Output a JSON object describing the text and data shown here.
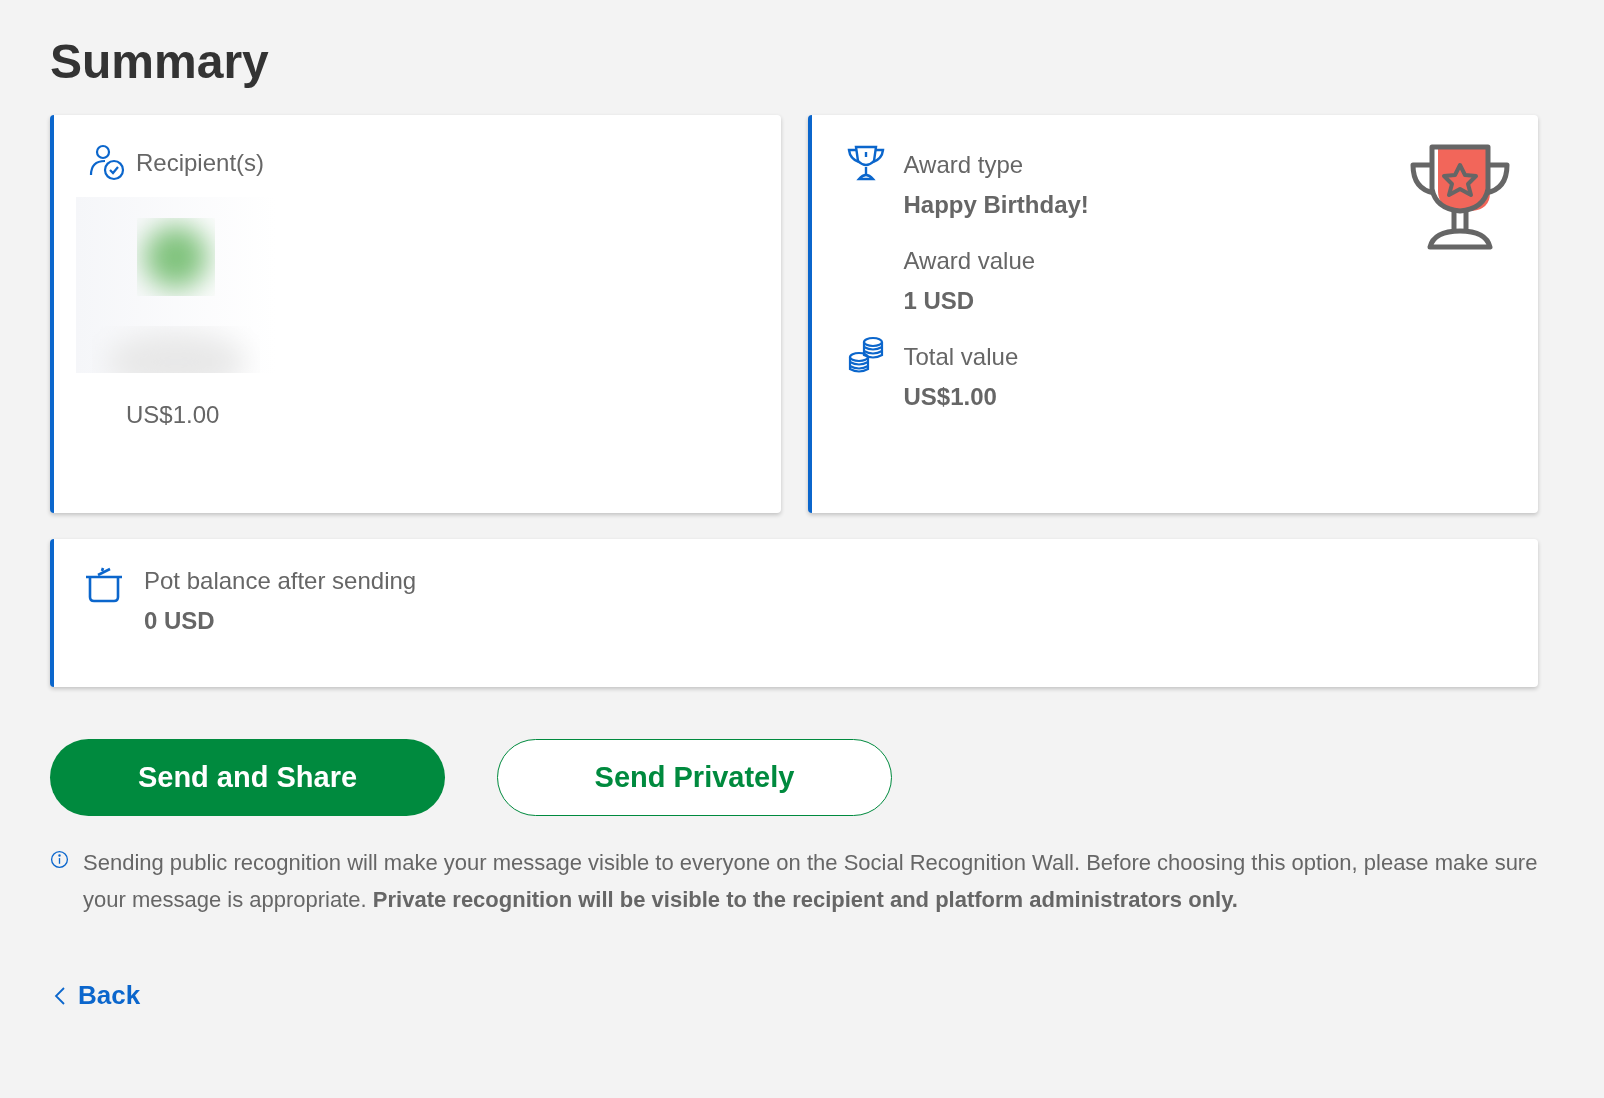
{
  "title": "Summary",
  "recipients": {
    "label": "Recipient(s)",
    "amount": "US$1.00"
  },
  "award": {
    "fields": [
      {
        "kind": "type",
        "label": "Award type",
        "value": "Happy Birthday!"
      },
      {
        "kind": "value",
        "label": "Award value",
        "value": "1 USD"
      },
      {
        "kind": "total",
        "label": "Total value",
        "value": "US$1.00"
      }
    ]
  },
  "pot": {
    "label": "Pot balance after sending",
    "value": "0 USD"
  },
  "buttons": [
    {
      "kind": "primary",
      "label": "Send and Share"
    },
    {
      "kind": "secondary",
      "label": "Send Privately"
    }
  ],
  "notice": "Sending public recognition will make your message visible to everyone on the Social Recognition Wall. Before choosing this option, please make sure your message is appropriate. **Private recognition will be visible to the recipient and platform administrators only.**",
  "back": "Back"
}
